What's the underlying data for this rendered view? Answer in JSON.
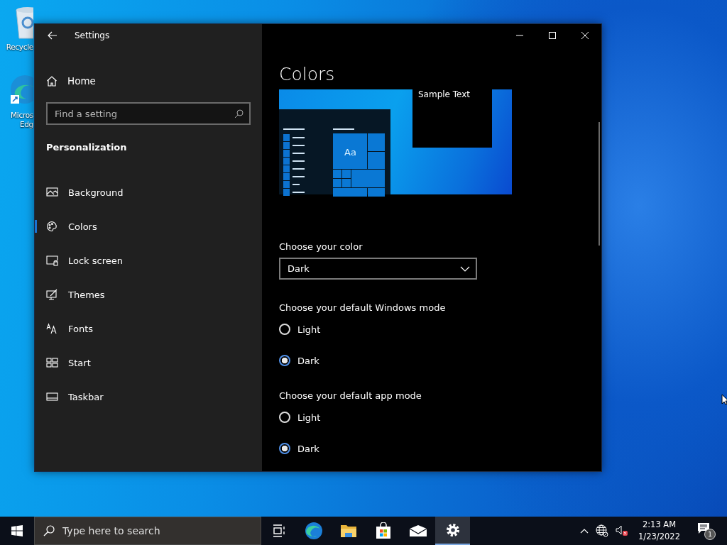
{
  "desktop_icons": [
    {
      "kind": "recycle-bin",
      "lines": [
        "Recycle"
      ]
    },
    {
      "kind": "edge",
      "lines": [
        "Micros",
        "Edg"
      ]
    }
  ],
  "window": {
    "title": "Settings",
    "home": "Home",
    "search": {
      "placeholder": "Find a setting"
    },
    "section": "Personalization",
    "nav": [
      {
        "kind": "background",
        "label": "Background",
        "selected": false
      },
      {
        "kind": "colors",
        "label": "Colors",
        "selected": true
      },
      {
        "kind": "lock",
        "label": "Lock screen",
        "selected": false
      },
      {
        "kind": "themes",
        "label": "Themes",
        "selected": false
      },
      {
        "kind": "fonts",
        "label": "Fonts",
        "selected": false
      },
      {
        "kind": "start",
        "label": "Start",
        "selected": false
      },
      {
        "kind": "taskbar",
        "label": "Taskbar",
        "selected": false
      }
    ],
    "heading": "Colors",
    "preview": {
      "sample_text": "Sample Text",
      "tile_text": "Aa"
    },
    "color_label": "Choose your color",
    "color_value": "Dark",
    "groups": [
      {
        "label": "Choose your default Windows mode",
        "options": [
          {
            "label": "Light",
            "selected": false
          },
          {
            "label": "Dark",
            "selected": true
          }
        ]
      },
      {
        "label": "Choose your default app mode",
        "options": [
          {
            "label": "Light",
            "selected": false
          },
          {
            "label": "Dark",
            "selected": true
          }
        ]
      }
    ]
  },
  "taskbar": {
    "search": {
      "placeholder": "Type here to search"
    },
    "apps": [
      {
        "kind": "task-view",
        "active": false
      },
      {
        "kind": "edge",
        "active": false
      },
      {
        "kind": "explorer",
        "active": false
      },
      {
        "kind": "store",
        "active": false
      },
      {
        "kind": "mail",
        "active": false
      },
      {
        "kind": "settings",
        "active": true
      }
    ],
    "time": "2:13 AM",
    "date": "1/23/2022",
    "notifications": "1"
  }
}
